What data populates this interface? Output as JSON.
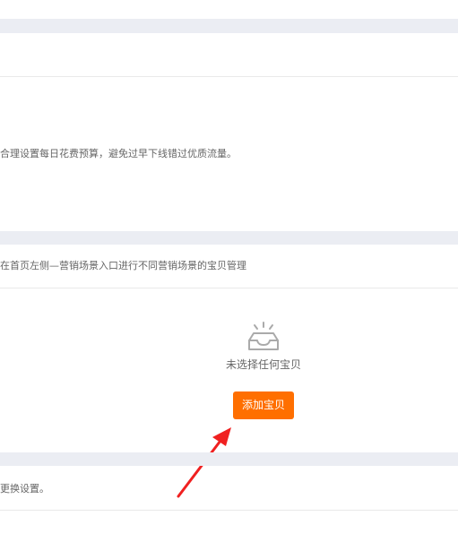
{
  "budget_section": {
    "hint": "合理设置每日花费预算，避免过早下线错过优质流量。"
  },
  "item_section": {
    "hint": "在首页左侧—营销场景入口进行不同营销场景的宝贝管理",
    "empty_icon": "empty-inbox-icon",
    "empty_text": "未选择任何宝贝",
    "add_label": "添加宝贝",
    "add_color": "#ff6f00"
  },
  "settings_section": {
    "hint": "更换设置。"
  },
  "annotation": {
    "arrow_icon": "red-arrow-icon",
    "arrow_color": "#f02020"
  }
}
